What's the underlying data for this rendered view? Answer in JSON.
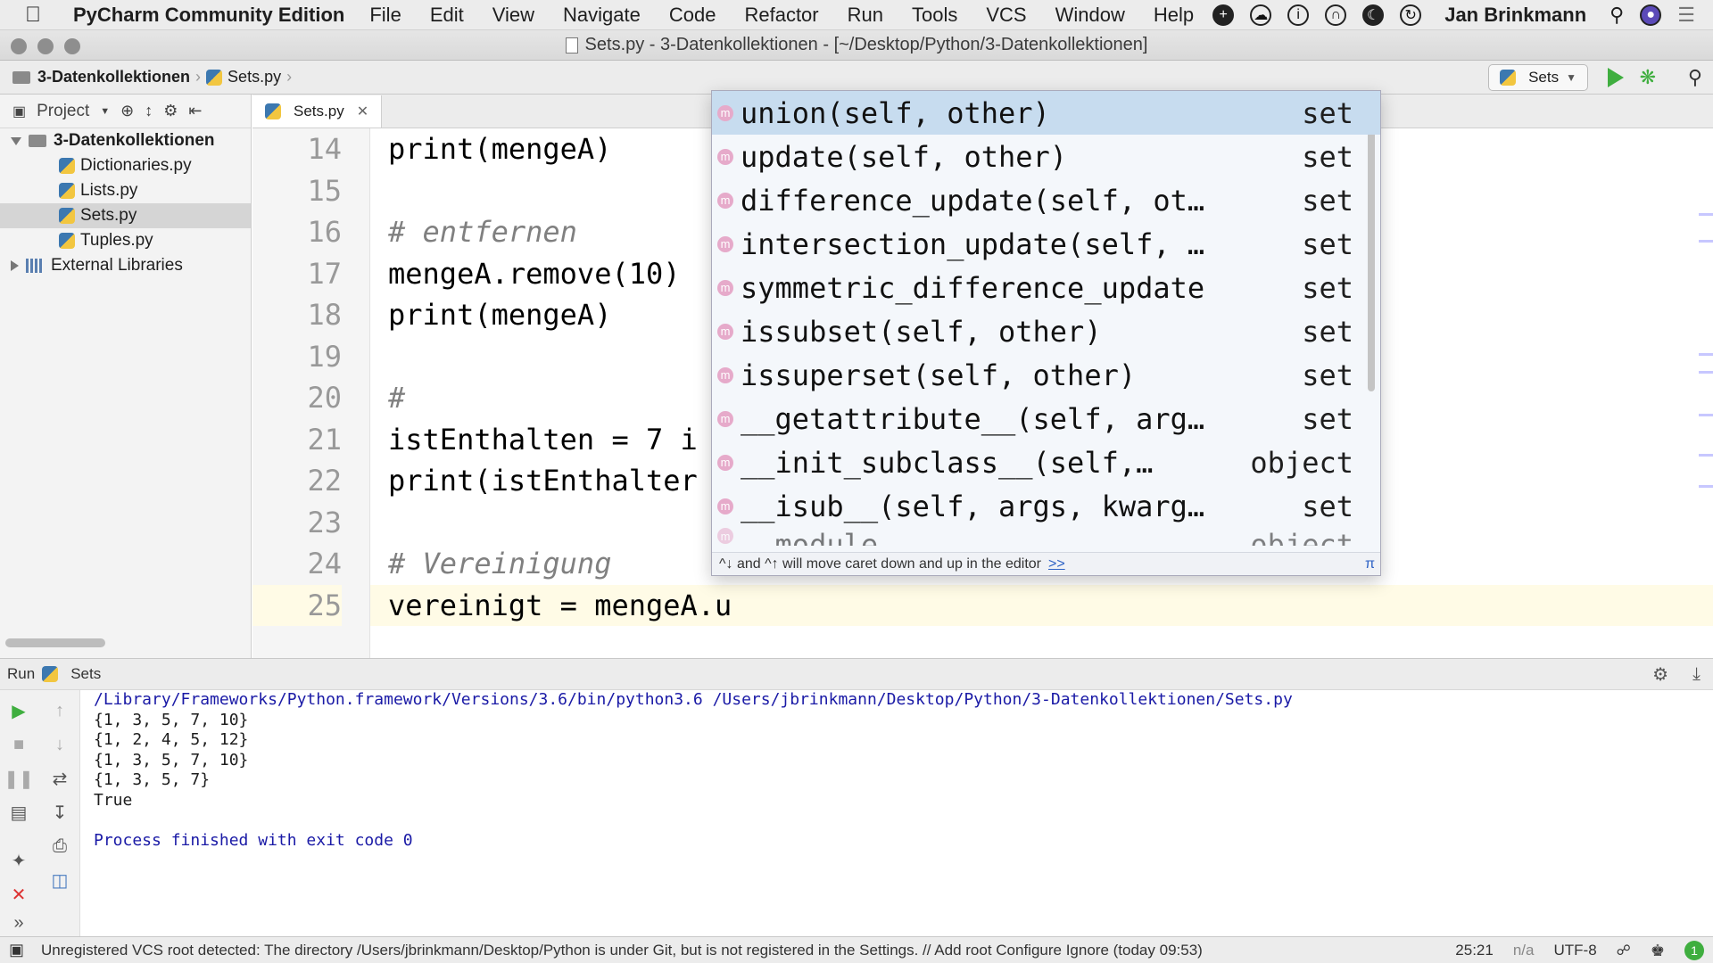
{
  "menubar": {
    "app_name": "PyCharm Community Edition",
    "menus": [
      "File",
      "Edit",
      "View",
      "Navigate",
      "Code",
      "Refactor",
      "Run",
      "Tools",
      "VCS",
      "Window",
      "Help"
    ],
    "user": "Jan Brinkmann"
  },
  "window": {
    "title": "Sets.py - 3-Datenkollektionen - [~/Desktop/Python/3-Datenkollektionen]"
  },
  "navbar": {
    "crumbs": [
      "3-Datenkollektionen",
      "Sets.py"
    ],
    "run_config": "Sets"
  },
  "project": {
    "view_label": "Project",
    "root": "3-Datenkollektionen",
    "files": [
      "Dictionaries.py",
      "Lists.py",
      "Sets.py",
      "Tuples.py"
    ],
    "selected_file": "Sets.py",
    "external": "External Libraries"
  },
  "editor": {
    "tab_label": "Sets.py",
    "lines": [
      {
        "num": "14",
        "text": "print(mengeA)",
        "kind": "code"
      },
      {
        "num": "15",
        "text": "",
        "kind": "code"
      },
      {
        "num": "16",
        "text": "# entfernen",
        "kind": "comment"
      },
      {
        "num": "17",
        "text": "mengeA.remove(10)",
        "kind": "code"
      },
      {
        "num": "18",
        "text": "print(mengeA)",
        "kind": "code"
      },
      {
        "num": "19",
        "text": "",
        "kind": "code"
      },
      {
        "num": "20",
        "text": "#",
        "kind": "comment"
      },
      {
        "num": "21",
        "text": "istEnthalten = 7 i",
        "kind": "code"
      },
      {
        "num": "22",
        "text": "print(istEnthalter",
        "kind": "code"
      },
      {
        "num": "23",
        "text": "",
        "kind": "code"
      },
      {
        "num": "24",
        "text": "# Vereinigung",
        "kind": "comment"
      },
      {
        "num": "25",
        "text": "vereinigt = mengeA.u",
        "kind": "code"
      }
    ],
    "current_line": "25"
  },
  "completion": {
    "items": [
      {
        "label": "union(self, other)",
        "type": "set"
      },
      {
        "label": "update(self, other)",
        "type": "set"
      },
      {
        "label": "difference_update(self, ot…",
        "type": "set"
      },
      {
        "label": "intersection_update(self, …",
        "type": "set"
      },
      {
        "label": "symmetric_difference_update",
        "type": "set"
      },
      {
        "label": "issubset(self, other)",
        "type": "set"
      },
      {
        "label": "issuperset(self, other)",
        "type": "set"
      },
      {
        "label": "__getattribute__(self, arg…",
        "type": "set"
      },
      {
        "label": "__init_subclass__(self,…",
        "type": "object"
      },
      {
        "label": "__isub__(self, args, kwarg…",
        "type": "set"
      },
      {
        "label": "__module__",
        "type": "object"
      }
    ],
    "footer": "^↓ and ^↑ will move caret down and up in the editor",
    "footer_more": ">>",
    "footer_pi": "π"
  },
  "run": {
    "tab_label": "Run",
    "config": "Sets",
    "output": [
      "/Library/Frameworks/Python.framework/Versions/3.6/bin/python3.6 /Users/jbrinkmann/Desktop/Python/3-Datenkollektionen/Sets.py",
      "{1, 3, 5, 7, 10}",
      "{1, 2, 4, 5, 12}",
      "{1, 3, 5, 7, 10}",
      "{1, 3, 5, 7}",
      "True",
      "",
      "Process finished with exit code 0"
    ]
  },
  "statusbar": {
    "message": "Unregistered VCS root detected: The directory /Users/jbrinkmann/Desktop/Python is under Git, but is not registered in the Settings. // Add root  Configure  Ignore (today 09:53)",
    "position": "25:21",
    "na": "n/a",
    "encoding": "UTF-8",
    "badge": "1"
  }
}
